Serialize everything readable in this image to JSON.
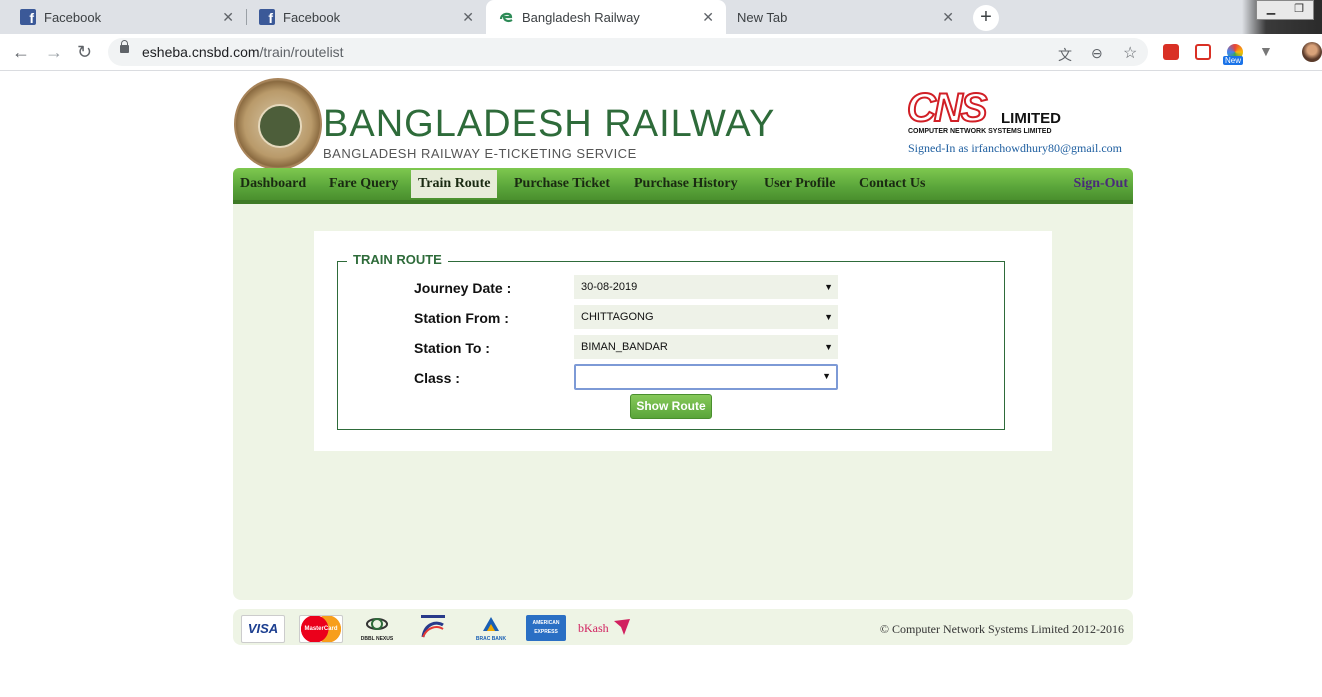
{
  "browser": {
    "tabs": [
      {
        "title": "Facebook",
        "icon": "facebook-icon",
        "active": false
      },
      {
        "title": "Facebook",
        "icon": "facebook-icon",
        "active": false
      },
      {
        "title": "Bangladesh Railway",
        "icon": "edge-like-icon",
        "active": true
      },
      {
        "title": "New Tab",
        "icon": "",
        "active": false
      }
    ],
    "url_domain": "esheba.cnsbd.com",
    "url_path": "/train/routelist",
    "extension_badge": "New"
  },
  "header": {
    "title": "BANGLADESH RAILWAY",
    "subtitle": "BANGLADESH RAILWAY E-TICKETING SERVICE",
    "partner_logo_letters": "CNS",
    "partner_logo_suffix": "LIMITED",
    "partner_logo_fullname": "COMPUTER NETWORK SYSTEMS LIMITED",
    "signed_in": "Signed-In as irfanchowdhury80@gmail.com"
  },
  "nav": {
    "items": [
      "Dashboard",
      "Fare Query",
      "Train Route",
      "Purchase Ticket",
      "Purchase History",
      "User Profile",
      "Contact Us"
    ],
    "active": "Train Route",
    "signout": "Sign-Out"
  },
  "form": {
    "legend": "TRAIN ROUTE",
    "journey_date_label": "Journey Date :",
    "journey_date_value": "30-08-2019",
    "station_from_label": "Station From :",
    "station_from_value": "CHITTAGONG",
    "station_to_label": "Station To :",
    "station_to_value": "BIMAN_BANDAR",
    "class_label": "Class :",
    "class_value": "",
    "submit_label": "Show Route"
  },
  "footer": {
    "payment_methods": [
      "VISA",
      "MasterCard",
      "DBBL NEXUS",
      "Rocket",
      "BRAC BANK",
      "AMERICAN EXPRESS",
      "bKash"
    ],
    "copyright": "© Computer Network Systems Limited 2012-2016"
  },
  "colors": {
    "brand_green": "#2e6b3a",
    "nav_green": "#5aa53a",
    "content_bg": "#eef4e5",
    "cns_red": "#d11f26"
  }
}
